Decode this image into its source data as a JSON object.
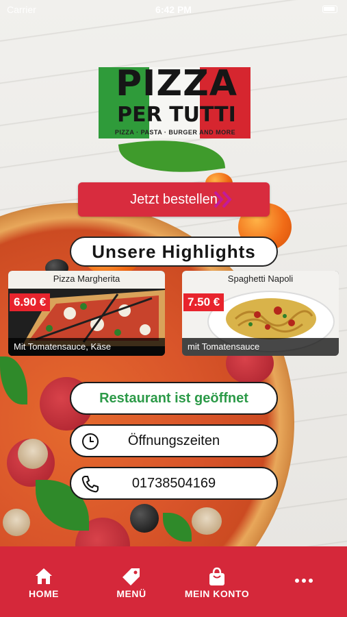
{
  "status_bar": {
    "carrier": "Carrier",
    "time": "6:42 PM"
  },
  "logo": {
    "line1": "PIZZA",
    "line2": "PER TUTTI",
    "tagline": "PIZZA · PASTA · BURGER AND MORE"
  },
  "order_button": {
    "label": "Jetzt bestellen",
    "icon": "double-chevron-right-icon",
    "color": "#d82c3e"
  },
  "highlights": {
    "title": "Unsere Highlights",
    "items": [
      {
        "name": "Pizza Margherita",
        "price": "6.90 €",
        "description": "Mit Tomatensauce, Käse"
      },
      {
        "name": "Spaghetti Napoli",
        "price": "7.50 €",
        "description": "mit Tomatensauce"
      }
    ]
  },
  "info": {
    "status": "Restaurant ist geöffnet",
    "status_color": "#2c9a48",
    "hours_label": "Öffnungszeiten",
    "phone": "01738504169"
  },
  "nav": {
    "color": "#d5283a",
    "items": [
      {
        "label": "HOME",
        "icon": "home-icon"
      },
      {
        "label": "MENÜ",
        "icon": "tag-icon"
      },
      {
        "label": "MEIN KONTO",
        "icon": "shopping-bag-icon"
      },
      {
        "label": "",
        "icon": "more-dots-icon"
      }
    ]
  }
}
